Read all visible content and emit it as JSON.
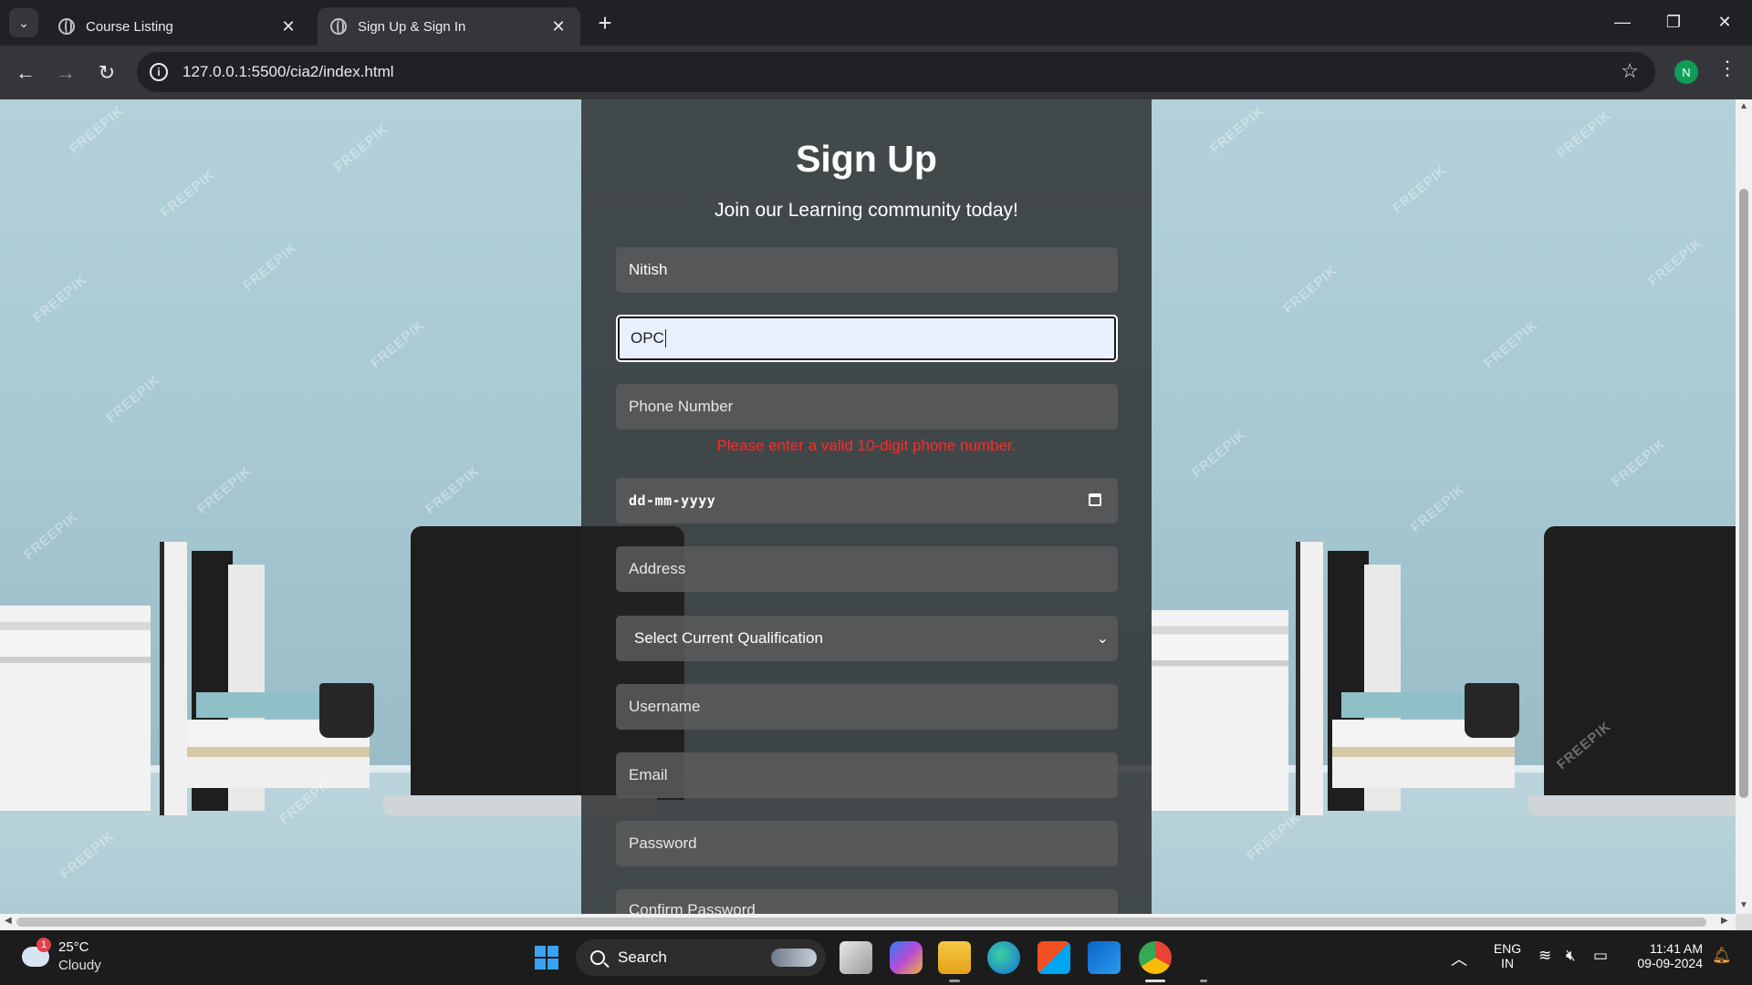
{
  "browser": {
    "tabs": [
      {
        "title": "Course Listing",
        "active": false
      },
      {
        "title": "Sign Up & Sign In",
        "active": true
      }
    ],
    "url": "127.0.0.1:5500/cia2/index.html",
    "profile_initial": "N"
  },
  "watermark_text": "FREEPIK",
  "form": {
    "title": "Sign Up",
    "subtitle": "Join our Learning community today!",
    "first_name": "Nitish",
    "last_name": "OPC",
    "phone_placeholder": "Phone Number",
    "phone_error": "Please enter a valid 10-digit phone number.",
    "dob_placeholder": "dd-mm-yyyy",
    "address_placeholder": "Address",
    "qualification_selected": "Select Current Qualification",
    "username_placeholder": "Username",
    "email_placeholder": "Email",
    "password_placeholder": "Password",
    "confirm_password_placeholder": "Confirm Password"
  },
  "taskbar": {
    "weather_temp": "25°C",
    "weather_condition": "Cloudy",
    "weather_badge": "1",
    "search_label": "Search",
    "language": "ENG",
    "region": "IN",
    "time": "11:41 AM",
    "date": "09-09-2024"
  },
  "colors": {
    "error": "#ff2a2a",
    "chrome_bg": "#202124",
    "toolbar_bg": "#35363a",
    "card_bg": "#232323",
    "accent_start": "#3aa3f5"
  }
}
